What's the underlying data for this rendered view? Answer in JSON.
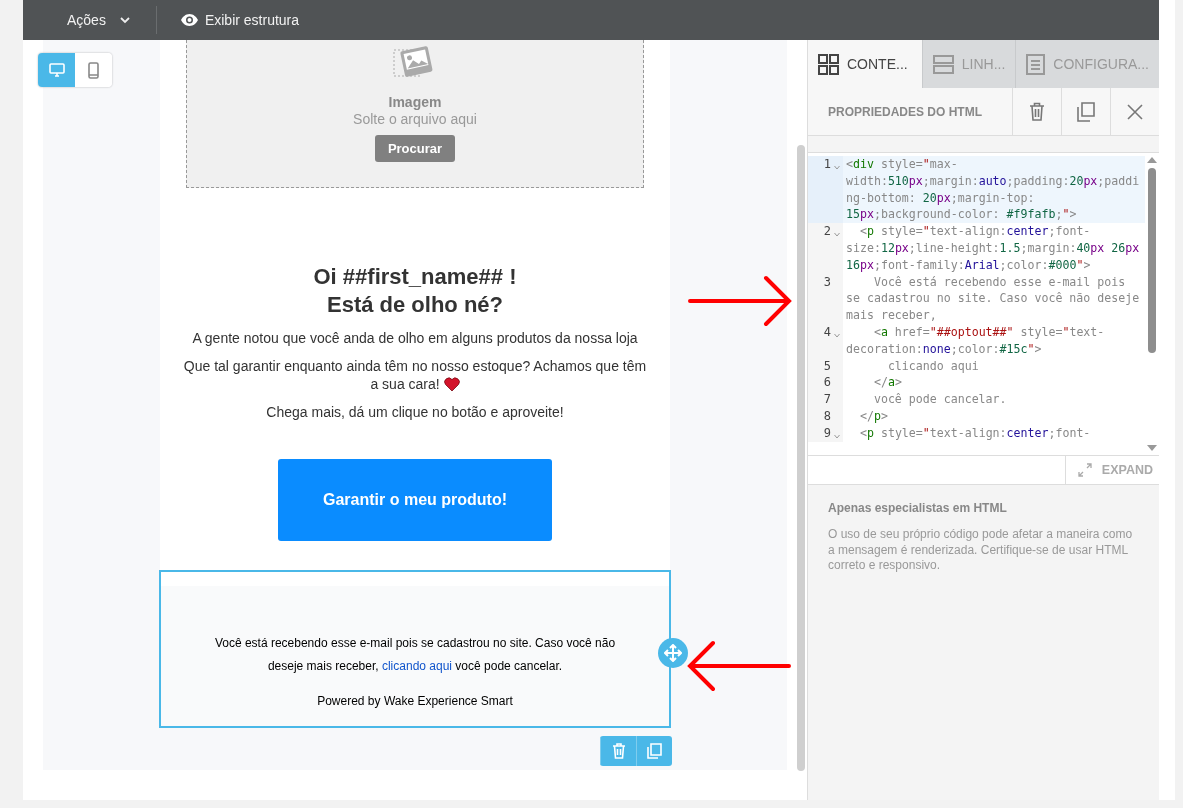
{
  "toolbar": {
    "actions_menu": "Ações",
    "structure_toggle": "Exibir estrutura"
  },
  "device_toggle": [
    {
      "kind": "desktop",
      "selected": true
    },
    {
      "kind": "mobile",
      "selected": false
    }
  ],
  "email": {
    "image_placeholder": {
      "title": "Imagem",
      "hint": "Solte o arquivo aqui",
      "button": "Procurar"
    },
    "heading": [
      "Oi ##first_name## !",
      "Está de olho né?"
    ],
    "paragraphs": [
      "A gente notou que você anda de olho em alguns produtos da nossa loja",
      "Que tal garantir enquanto ainda têm no nosso estoque? Achamos que têm a sua cara!",
      "Chega mais, dá um clique no botão e aproveite!"
    ],
    "cta_button": "Garantir o meu produto!",
    "footer": {
      "selected": true,
      "text_before": "Você está recebendo esse e-mail pois se cadastrou no site. Caso você não deseje mais receber,",
      "link": "clicando aqui",
      "text_after": "você pode cancelar.",
      "powered_by": "Powered by Wake Experience Smart"
    }
  },
  "panel": {
    "tabs": [
      {
        "kind": "content",
        "label": "CONTE...",
        "selected": true
      },
      {
        "kind": "rows",
        "label": "LINH...",
        "selected": false
      },
      {
        "kind": "settings",
        "label": "CONFIGURA...",
        "selected": false
      }
    ],
    "title": "PROPRIEDADES DO HTML",
    "code_lines": [
      {
        "number": "1",
        "foldable": true,
        "highlighted": true,
        "tokens": [
          {
            "kind": "plain",
            "text": "<"
          },
          {
            "kind": "tag",
            "text": "div"
          },
          {
            "kind": "plain",
            "text": " style="
          },
          {
            "kind": "quote",
            "text": "\""
          },
          {
            "kind": "plain",
            "text": "max-width:"
          },
          {
            "kind": "number",
            "text": "510"
          },
          {
            "kind": "unit",
            "text": "px"
          },
          {
            "kind": "plain",
            "text": ";margin:"
          },
          {
            "kind": "keyword",
            "text": "auto"
          },
          {
            "kind": "plain",
            "text": ";padding:"
          },
          {
            "kind": "number",
            "text": "20"
          },
          {
            "kind": "unit",
            "text": "px"
          },
          {
            "kind": "plain",
            "text": ";padding-bottom: "
          },
          {
            "kind": "number",
            "text": "20"
          },
          {
            "kind": "unit",
            "text": "px"
          },
          {
            "kind": "plain",
            "text": ";margin-top: "
          },
          {
            "kind": "number",
            "text": "15"
          },
          {
            "kind": "unit",
            "text": "px"
          },
          {
            "kind": "plain",
            "text": ";background-color: "
          },
          {
            "kind": "number",
            "text": "#f9fafb"
          },
          {
            "kind": "plain",
            "text": ";"
          },
          {
            "kind": "quote",
            "text": "\""
          },
          {
            "kind": "plain",
            "text": ">"
          }
        ]
      },
      {
        "number": "2",
        "foldable": true,
        "highlighted": false,
        "tokens": [
          {
            "kind": "plain",
            "text": "  <"
          },
          {
            "kind": "tag",
            "text": "p"
          },
          {
            "kind": "plain",
            "text": " style="
          },
          {
            "kind": "quote",
            "text": "\""
          },
          {
            "kind": "plain",
            "text": "text-align:"
          },
          {
            "kind": "keyword",
            "text": "center"
          },
          {
            "kind": "plain",
            "text": ";font-size:"
          },
          {
            "kind": "number",
            "text": "12"
          },
          {
            "kind": "unit",
            "text": "px"
          },
          {
            "kind": "plain",
            "text": ";line-height:"
          },
          {
            "kind": "number",
            "text": "1.5"
          },
          {
            "kind": "plain",
            "text": ";margin:"
          },
          {
            "kind": "number",
            "text": "40"
          },
          {
            "kind": "unit",
            "text": "px "
          },
          {
            "kind": "number",
            "text": "26"
          },
          {
            "kind": "unit",
            "text": "px "
          },
          {
            "kind": "number",
            "text": "16"
          },
          {
            "kind": "unit",
            "text": "px"
          },
          {
            "kind": "plain",
            "text": ";font-family:"
          },
          {
            "kind": "keyword",
            "text": "Arial"
          },
          {
            "kind": "plain",
            "text": ";color:"
          },
          {
            "kind": "number",
            "text": "#000"
          },
          {
            "kind": "quote",
            "text": "\""
          },
          {
            "kind": "plain",
            "text": ">"
          }
        ]
      },
      {
        "number": "3",
        "foldable": false,
        "highlighted": false,
        "tokens": [
          {
            "kind": "plain",
            "text": "    Você está recebendo esse e-mail pois se cadastrou no site. Caso você não deseje mais receber,"
          }
        ]
      },
      {
        "number": "4",
        "foldable": true,
        "highlighted": false,
        "tokens": [
          {
            "kind": "plain",
            "text": "    <"
          },
          {
            "kind": "tag",
            "text": "a"
          },
          {
            "kind": "plain",
            "text": " href="
          },
          {
            "kind": "quote",
            "text": "\"##optout##\""
          },
          {
            "kind": "plain",
            "text": " style="
          },
          {
            "kind": "quote",
            "text": "\""
          },
          {
            "kind": "plain",
            "text": "text-decoration:"
          },
          {
            "kind": "keyword",
            "text": "none"
          },
          {
            "kind": "plain",
            "text": ";color:"
          },
          {
            "kind": "number",
            "text": "#15c"
          },
          {
            "kind": "quote",
            "text": "\""
          },
          {
            "kind": "plain",
            "text": ">"
          }
        ]
      },
      {
        "number": "5",
        "foldable": false,
        "highlighted": false,
        "tokens": [
          {
            "kind": "plain",
            "text": "      clicando aqui"
          }
        ]
      },
      {
        "number": "6",
        "foldable": false,
        "highlighted": false,
        "tokens": [
          {
            "kind": "plain",
            "text": "    </"
          },
          {
            "kind": "tag",
            "text": "a"
          },
          {
            "kind": "plain",
            "text": ">"
          }
        ]
      },
      {
        "number": "7",
        "foldable": false,
        "highlighted": false,
        "tokens": [
          {
            "kind": "plain",
            "text": "    você pode cancelar."
          }
        ]
      },
      {
        "number": "8",
        "foldable": false,
        "highlighted": false,
        "tokens": [
          {
            "kind": "plain",
            "text": "  </"
          },
          {
            "kind": "tag",
            "text": "p"
          },
          {
            "kind": "plain",
            "text": ">"
          }
        ]
      },
      {
        "number": "9",
        "foldable": true,
        "highlighted": false,
        "tokens": [
          {
            "kind": "plain",
            "text": "  <"
          },
          {
            "kind": "tag",
            "text": "p"
          },
          {
            "kind": "plain",
            "text": " style="
          },
          {
            "kind": "quote",
            "text": "\""
          },
          {
            "kind": "plain",
            "text": "text-align:"
          },
          {
            "kind": "keyword",
            "text": "center"
          },
          {
            "kind": "plain",
            "text": ";font-"
          }
        ]
      }
    ],
    "expand_button": "EXPAND",
    "notice_title": "Apenas especialistas em HTML",
    "notice_text": "O uso de seu próprio código pode afetar a maneira como a mensagem é renderizada. Certifique-se de usar HTML correto e responsivo."
  }
}
